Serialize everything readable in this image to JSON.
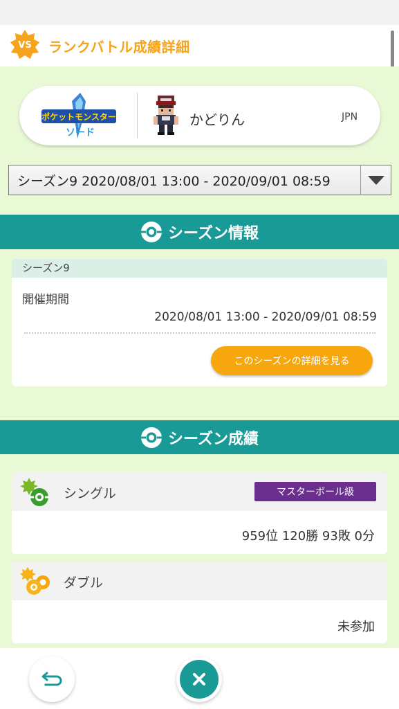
{
  "header": {
    "badge": "VS",
    "title": "ランクバトル成績詳細"
  },
  "player": {
    "game_logo": "ポケットモンスター ソード",
    "name": "かどりん",
    "region": "JPN"
  },
  "season_select": {
    "value": "シーズン9 2020/08/01 13:00 - 2020/09/01 08:59"
  },
  "season_info": {
    "section_title": "シーズン情報",
    "card_title": "シーズン9",
    "period_label": "開催期間",
    "period_value": "2020/08/01 13:00 - 2020/09/01 08:59",
    "detail_button": "このシーズンの詳細を見る"
  },
  "season_results": {
    "section_title": "シーズン成績",
    "single": {
      "label": "シングル",
      "rank_badge": "マスターボール級",
      "value": "959位 120勝 93敗 0分"
    },
    "double": {
      "label": "ダブル",
      "value": "未参加"
    }
  },
  "colors": {
    "accent": "#199a96",
    "header_orange": "#f5a41c",
    "button_orange": "#f7a70d",
    "badge_purple": "#6a2e8c",
    "bg_green": "#e9f9d6"
  },
  "icons": {
    "back": "return-arrow-icon",
    "close": "close-icon"
  }
}
